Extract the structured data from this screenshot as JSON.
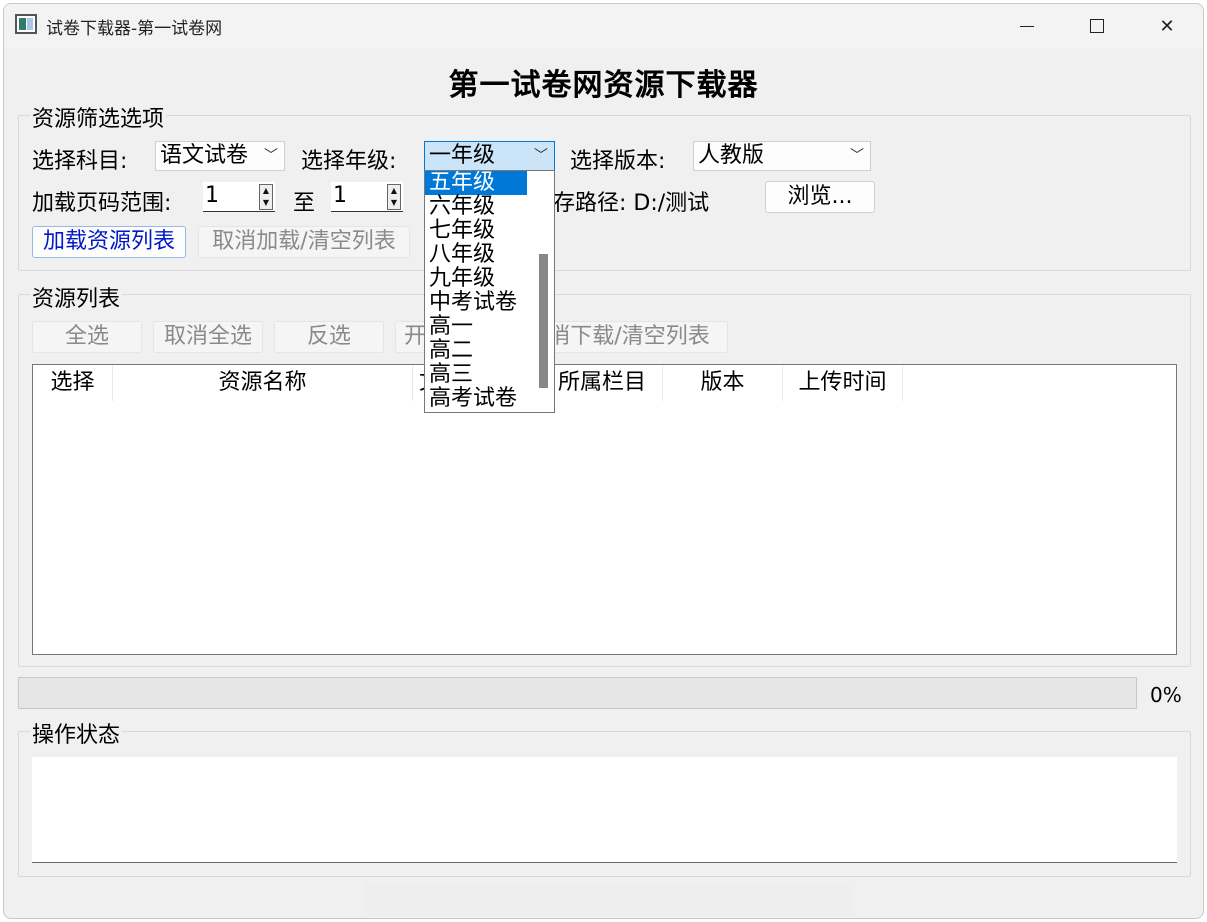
{
  "window": {
    "title": "试卷下载器-第一试卷网",
    "close_glyph": "✕"
  },
  "main_title": "第一试卷网资源下载器",
  "filter": {
    "group_title": "资源筛选选项",
    "subject_label": "选择科目:",
    "subject_value": "语文试卷",
    "grade_label": "选择年级:",
    "grade_value": "一年级",
    "edition_label": "选择版本:",
    "edition_value": "人教版",
    "page_range_label": "加载页码范围:",
    "page_from": "1",
    "to_label": "至",
    "page_to": "1",
    "save_path_label": "保存路径: D:/测试",
    "browse_button": "浏览...",
    "load_button": "加载资源列表",
    "cancel_load_button": "取消加载/清空列表"
  },
  "grade_dropdown": {
    "options": [
      "五年级",
      "六年级",
      "七年级",
      "八年级",
      "九年级",
      "中考试卷",
      "高一",
      "高二",
      "高三",
      "高考试卷"
    ],
    "highlighted": "五年级"
  },
  "resources": {
    "group_title": "资源列表",
    "select_all_button": "全选",
    "deselect_all_button": "取消全选",
    "invert_button": "反选",
    "start_download_button": "开",
    "cancel_download_button": "消下载/清空列表",
    "columns": [
      "选择",
      "资源名称",
      "文",
      "所属栏目",
      "版本",
      "上传时间"
    ],
    "rows": []
  },
  "progress": {
    "value_percent": 0,
    "label": "0%"
  },
  "status": {
    "group_title": "操作状态",
    "text": ""
  }
}
